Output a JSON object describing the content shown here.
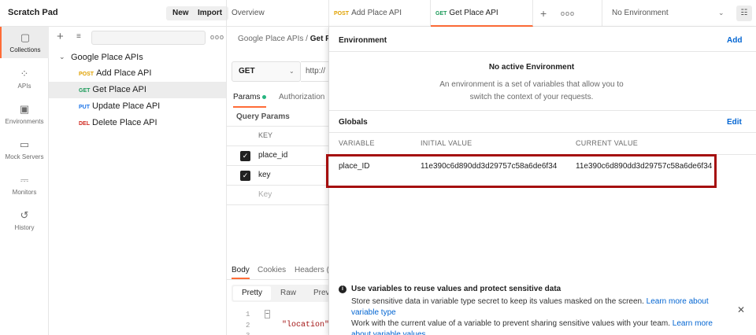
{
  "header": {
    "workspace": "Scratch Pad",
    "new_label": "New",
    "import_label": "Import",
    "tabs": [
      {
        "label": "Overview"
      },
      {
        "method": "POST",
        "label": "Add Place API"
      },
      {
        "method": "GET",
        "label": "Get Place API"
      }
    ],
    "add_tab": "+",
    "more": "ooo",
    "environment_select": "No Environment"
  },
  "rail": {
    "items": [
      {
        "label": "Collections"
      },
      {
        "label": "APIs"
      },
      {
        "label": "Environments"
      },
      {
        "label": "Mock Servers"
      },
      {
        "label": "Monitors"
      },
      {
        "label": "History"
      }
    ]
  },
  "collections": {
    "root": "Google Place APIs",
    "requests": [
      {
        "method": "POST",
        "label": "Add Place API"
      },
      {
        "method": "GET",
        "label": "Get Place API"
      },
      {
        "method": "PUT",
        "label": "Update Place API"
      },
      {
        "method": "DEL",
        "label": "Delete Place API"
      }
    ]
  },
  "request": {
    "breadcrumb_root": "Google Place APIs",
    "breadcrumb_sep": "/",
    "breadcrumb_current": "Get P",
    "method": "GET",
    "url": "http://",
    "tab_params": "Params",
    "tab_auth": "Authorization",
    "query_title": "Query Params",
    "params_header": "KEY",
    "params": [
      {
        "key": "place_id",
        "checked": true
      },
      {
        "key": "key",
        "checked": true
      }
    ],
    "params_placeholder": "Key",
    "body_tabs": [
      "Body",
      "Cookies",
      "Headers ("
    ],
    "view_modes": [
      "Pretty",
      "Raw",
      "Prev"
    ],
    "code_lines": [
      "1",
      "2",
      "3"
    ],
    "code_line2": "\"location\":",
    "code_line3": "\"lati"
  },
  "environment_panel": {
    "header": "Environment",
    "add_label": "Add",
    "no_env_title": "No active Environment",
    "no_env_desc": "An environment is a set of variables that allow you to switch the context of your requests.",
    "globals_header": "Globals",
    "edit_label": "Edit",
    "columns": [
      "VARIABLE",
      "INITIAL VALUE",
      "CURRENT VALUE"
    ],
    "globals": [
      {
        "variable": "place_ID",
        "initial": "11e390c6d890dd3d29757c58a6de6f34",
        "current": "11e390c6d890dd3d29757c58a6de6f34"
      }
    ],
    "info_title": "Use variables to reuse values and protect sensitive data",
    "info_line1": "Store sensitive data in variable type secret to keep its values masked on the screen.",
    "info_link1": "Learn more about variable type",
    "info_line2": "Work with the current value of a variable to prevent sharing sensitive values with your team.",
    "info_link2": "Learn more about variable values"
  },
  "colors": {
    "accent": "#ff6c37",
    "link": "#0265d2",
    "highlight": "#a50e0e"
  }
}
